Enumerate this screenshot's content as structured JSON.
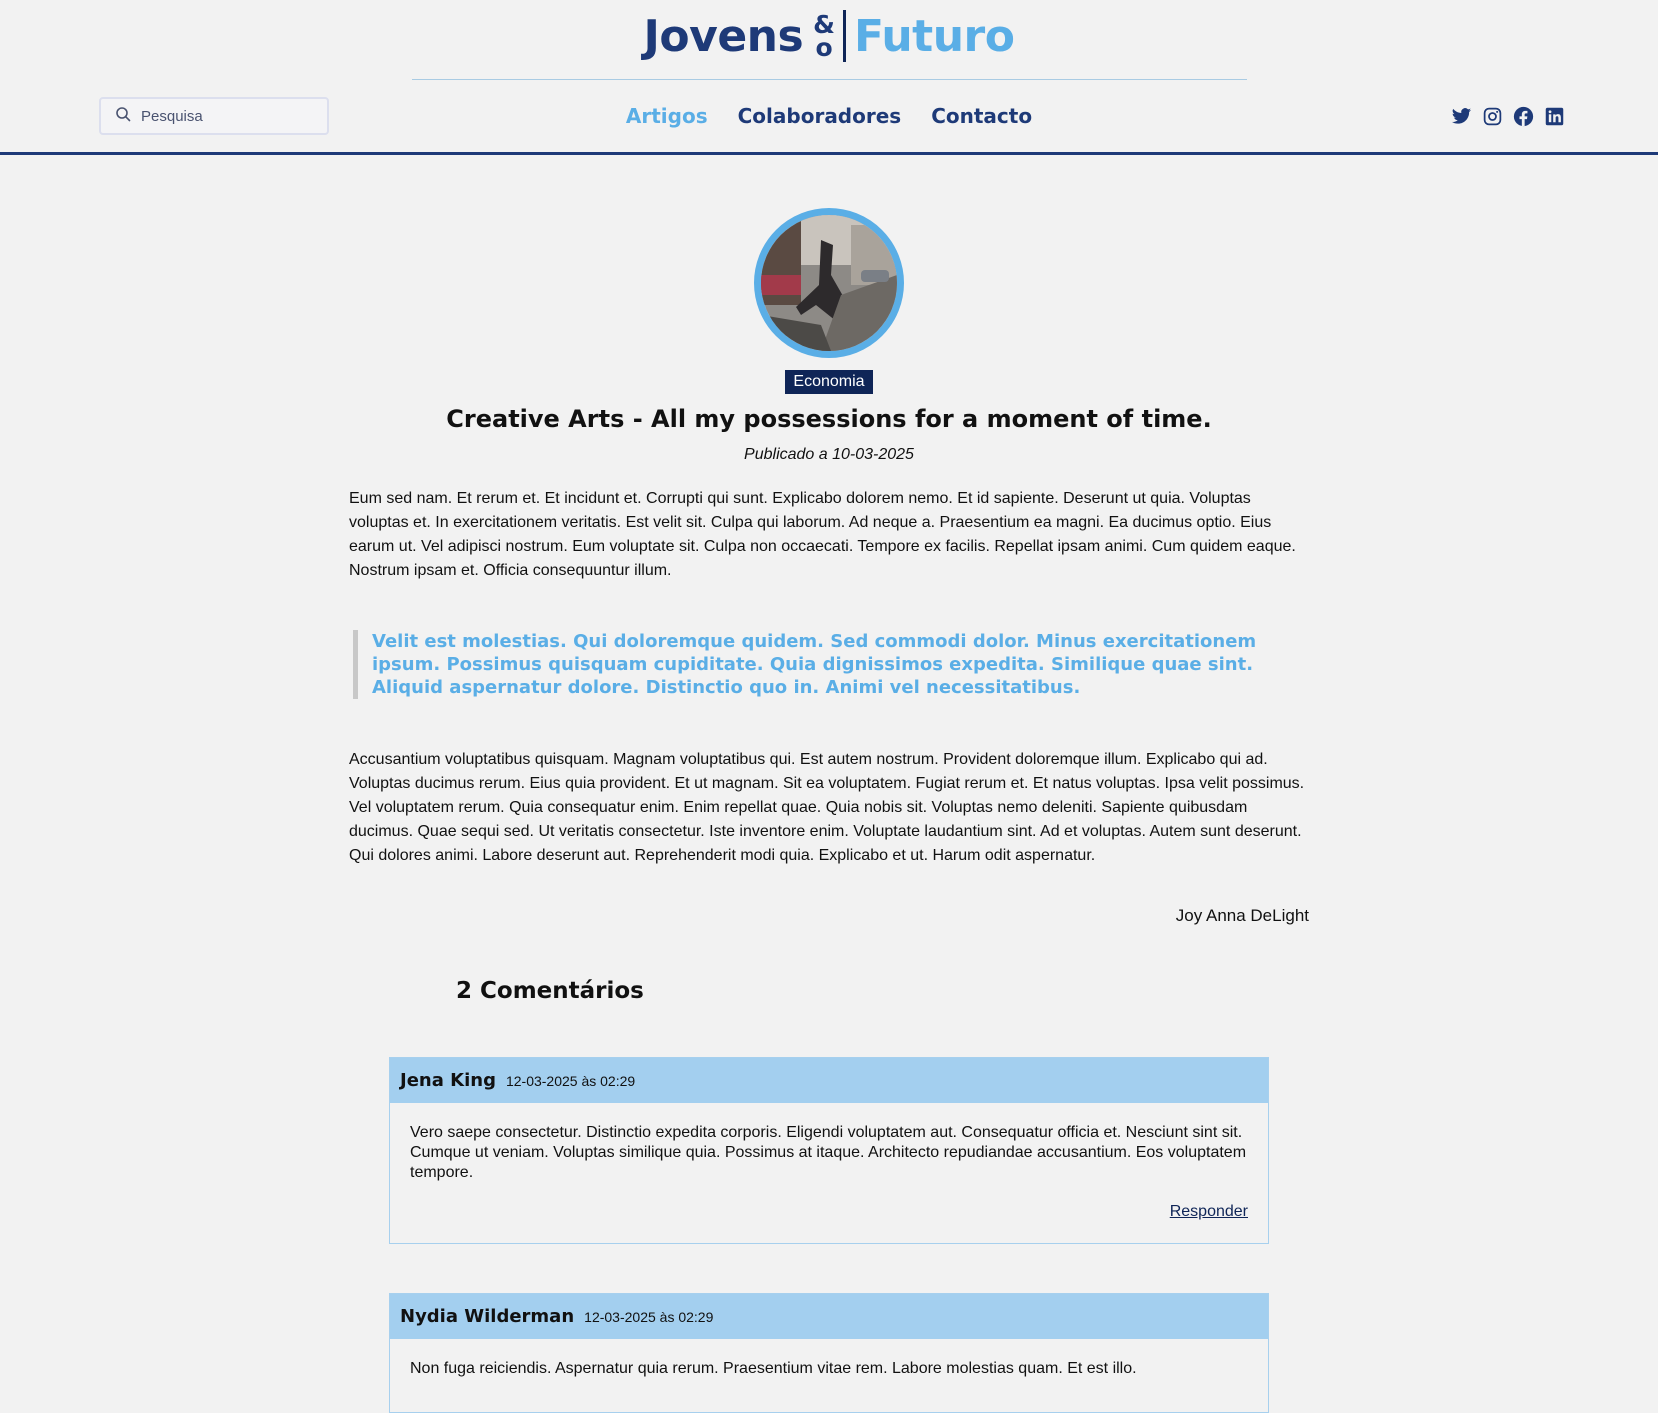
{
  "logo": {
    "word1": "Jovens",
    "amp_top": "&",
    "amp_bottom": "o",
    "word2": "Futuro"
  },
  "search": {
    "placeholder": "Pesquisa",
    "icon": "search-icon"
  },
  "nav": {
    "items": [
      "Artigos",
      "Colaboradores",
      "Contacto"
    ],
    "active": "Artigos"
  },
  "social": [
    "twitter-icon",
    "instagram-icon",
    "facebook-icon",
    "linkedin-icon"
  ],
  "colors": {
    "navy": "#1e3a78",
    "accent": "#5aaee6",
    "badge_bg": "#0f2557",
    "comment_header": "#a3cfef"
  },
  "article": {
    "category": "Economia",
    "title": "Creative Arts - All my possessions for a moment of time.",
    "date": "Publicado a 10-03-2025",
    "paragraph1": "Eum sed nam. Et rerum et. Et incidunt et. Corrupti qui sunt. Explicabo dolorem nemo. Et id sapiente. Deserunt ut quia. Voluptas voluptas et. In exercitationem veritatis. Est velit sit. Culpa qui laborum. Ad neque a. Praesentium ea magni. Ea ducimus optio. Eius earum ut. Vel adipisci nostrum. Eum voluptate sit. Culpa non occaecati. Tempore ex facilis. Repellat ipsam animi. Cum quidem eaque. Nostrum ipsam et. Officia consequuntur illum.",
    "quote": "Velit est molestias. Qui doloremque quidem. Sed commodi dolor. Minus exercitationem ipsum. Possimus quisquam cupiditate. Quia dignissimos expedita. Similique quae sint. Aliquid aspernatur dolore. Distinctio quo in. Animi vel necessitatibus.",
    "paragraph2": "Accusantium voluptatibus quisquam. Magnam voluptatibus qui. Est autem nostrum. Provident doloremque illum. Explicabo qui ad. Voluptas ducimus rerum. Eius quia provident. Et ut magnam. Sit ea voluptatem. Fugiat rerum et. Et natus voluptas. Ipsa velit possimus. Vel voluptatem rerum. Quia consequatur enim. Enim repellat quae. Quia nobis sit. Voluptas nemo deleniti. Sapiente quibusdam ducimus. Quae sequi sed. Ut veritatis consectetur. Iste inventore enim. Voluptate laudantium sint. Ad et voluptas. Autem sunt deserunt. Qui dolores animi. Labore deserunt aut. Reprehenderit modi quia. Explicabo et ut. Harum odit aspernatur.",
    "author": "Joy Anna DeLight"
  },
  "comments": {
    "title": "2 Comentários",
    "items": [
      {
        "name": "Jena King",
        "date": "12-03-2025 às 02:29",
        "text": "Vero saepe consectetur. Distinctio expedita corporis. Eligendi voluptatem aut. Consequatur officia et. Nesciunt sint sit. Cumque ut veniam. Voluptas similique quia. Possimus at itaque. Architecto repudiandae accusantium. Eos voluptatem tempore.",
        "reply": "Responder"
      },
      {
        "name": "Nydia Wilderman",
        "date": "12-03-2025 às 02:29",
        "text": "Non fuga reiciendis. Aspernatur quia rerum. Praesentium vitae rem. Labore molestias quam. Et est illo."
      }
    ]
  }
}
